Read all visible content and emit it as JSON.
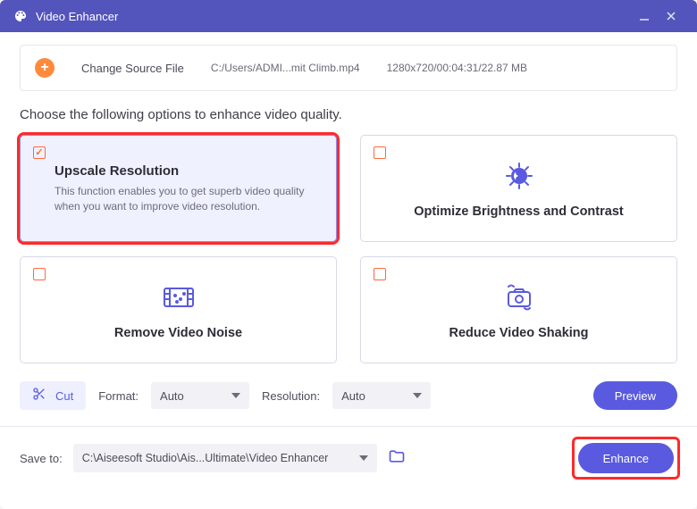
{
  "titlebar": {
    "title": "Video Enhancer"
  },
  "source": {
    "change_label": "Change Source File",
    "path": "C:/Users/ADMI...mit Climb.mp4",
    "info": "1280x720/00:04:31/22.87 MB"
  },
  "prompt": "Choose the following options to enhance video quality.",
  "options": [
    {
      "title": "Upscale Resolution",
      "desc": "This function enables you to get superb video quality when you want to improve video resolution.",
      "checked": true,
      "highlighted": true
    },
    {
      "title": "Optimize Brightness and Contrast",
      "checked": false
    },
    {
      "title": "Remove Video Noise",
      "checked": false
    },
    {
      "title": "Reduce Video Shaking",
      "checked": false
    }
  ],
  "toolbar": {
    "cut_label": "Cut",
    "format_label": "Format:",
    "format_value": "Auto",
    "resolution_label": "Resolution:",
    "resolution_value": "Auto",
    "preview_label": "Preview"
  },
  "save": {
    "label": "Save to:",
    "path": "C:\\Aiseesoft Studio\\Ais...Ultimate\\Video Enhancer",
    "enhance_label": "Enhance"
  }
}
